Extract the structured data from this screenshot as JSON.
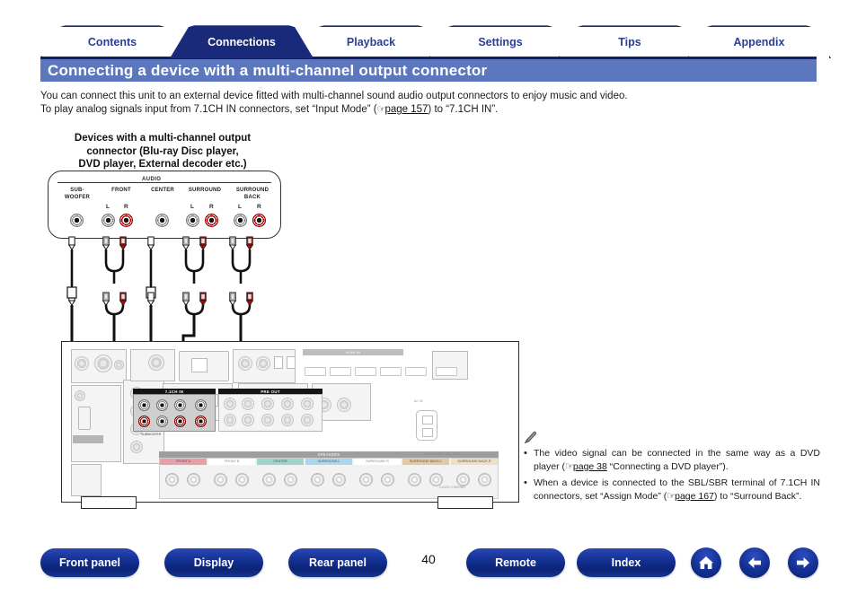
{
  "tabs": [
    {
      "label": "Contents",
      "active": false
    },
    {
      "label": "Connections",
      "active": true
    },
    {
      "label": "Playback",
      "active": false
    },
    {
      "label": "Settings",
      "active": false
    },
    {
      "label": "Tips",
      "active": false
    },
    {
      "label": "Appendix",
      "active": false
    }
  ],
  "header": {
    "title": "Connecting a device with a multi-channel output connector",
    "title_bar_color": "#5d77bf",
    "active_tab_color": "#1a2a7a",
    "tab_text_color": "#2b3f95"
  },
  "intro": {
    "line1": "You can connect this unit to an external device fitted with multi-channel sound audio output connectors to enjoy music and video.",
    "line2_a": "To play analog signals input from 7.1CH IN connectors, set “Input Mode” (",
    "line2_link": "page 157",
    "line2_b": ") to “7.1CH IN”."
  },
  "diagram": {
    "device_caption": {
      "line1": "Devices with a multi-channel output",
      "line2": "connector (Blu-ray Disc player,",
      "line3": "DVD player, External decoder etc.)"
    },
    "source_panel": {
      "audio_label": "AUDIO",
      "groups": [
        {
          "name": "SUB-\nWOOFER",
          "line1": "SUB-",
          "line2": "WOOFER",
          "jacks": [
            "mono"
          ],
          "lr": []
        },
        {
          "name": "FRONT",
          "line1": "FRONT",
          "line2": "",
          "jacks": [
            "white",
            "red"
          ],
          "lr": [
            "L",
            "R"
          ]
        },
        {
          "name": "CENTER",
          "line1": "CENTER",
          "line2": "",
          "jacks": [
            "mono"
          ],
          "lr": []
        },
        {
          "name": "SURROUND",
          "line1": "SURROUND",
          "line2": "",
          "jacks": [
            "white",
            "red"
          ],
          "lr": [
            "L",
            "R"
          ]
        },
        {
          "name": "SURROUND BACK",
          "line1": "SURROUND",
          "line2": "BACK",
          "jacks": [
            "white",
            "red"
          ],
          "lr": [
            "L",
            "R"
          ]
        }
      ]
    },
    "receiver": {
      "chin_label": "7.1CH IN",
      "pre_label": "PRE OUT",
      "chin_sub": "SUBWOOFER",
      "speaker_label": "SPEAKERS",
      "impedance_label": "IMPEDANCE ·6Ω—16Ω",
      "ac_label": "AC IN",
      "class_label": "CLASS 2 WIRING",
      "speaker_groups": [
        {
          "label": "FRONT A",
          "color": "#e8a0a8"
        },
        {
          "label": "FRONT B",
          "color": "#ffffff"
        },
        {
          "label": "CENTER",
          "color": "#9ed6c9"
        },
        {
          "label": "SURROUND L",
          "color": "#a9d8ee"
        },
        {
          "label": "SURROUND R",
          "color": "#ffffff"
        },
        {
          "label": "SURROUND BACK L",
          "color": "#e6c9a0"
        },
        {
          "label": "SURROUND BACK R",
          "color": "#f0dfc2"
        }
      ]
    }
  },
  "notes": {
    "icon": "pencil-icon",
    "items": [
      {
        "a": "The video signal can be connected in the same way as a DVD player (",
        "link": "page 38",
        "b": " “Connecting a DVD player”)."
      },
      {
        "a": "When a device is connected to the SBL/SBR terminal of 7.1CH IN connectors, set “Assign Mode” (",
        "link": "page 167",
        "b": ") to “Surround Back”."
      }
    ]
  },
  "footer": {
    "buttons": [
      {
        "label": "Front panel"
      },
      {
        "label": "Display"
      },
      {
        "label": "Rear panel"
      },
      {
        "label": "Remote"
      },
      {
        "label": "Index"
      }
    ],
    "page_number": "40",
    "icons": [
      {
        "name": "home-icon"
      },
      {
        "name": "arrow-left-icon"
      },
      {
        "name": "arrow-right-icon"
      }
    ]
  }
}
